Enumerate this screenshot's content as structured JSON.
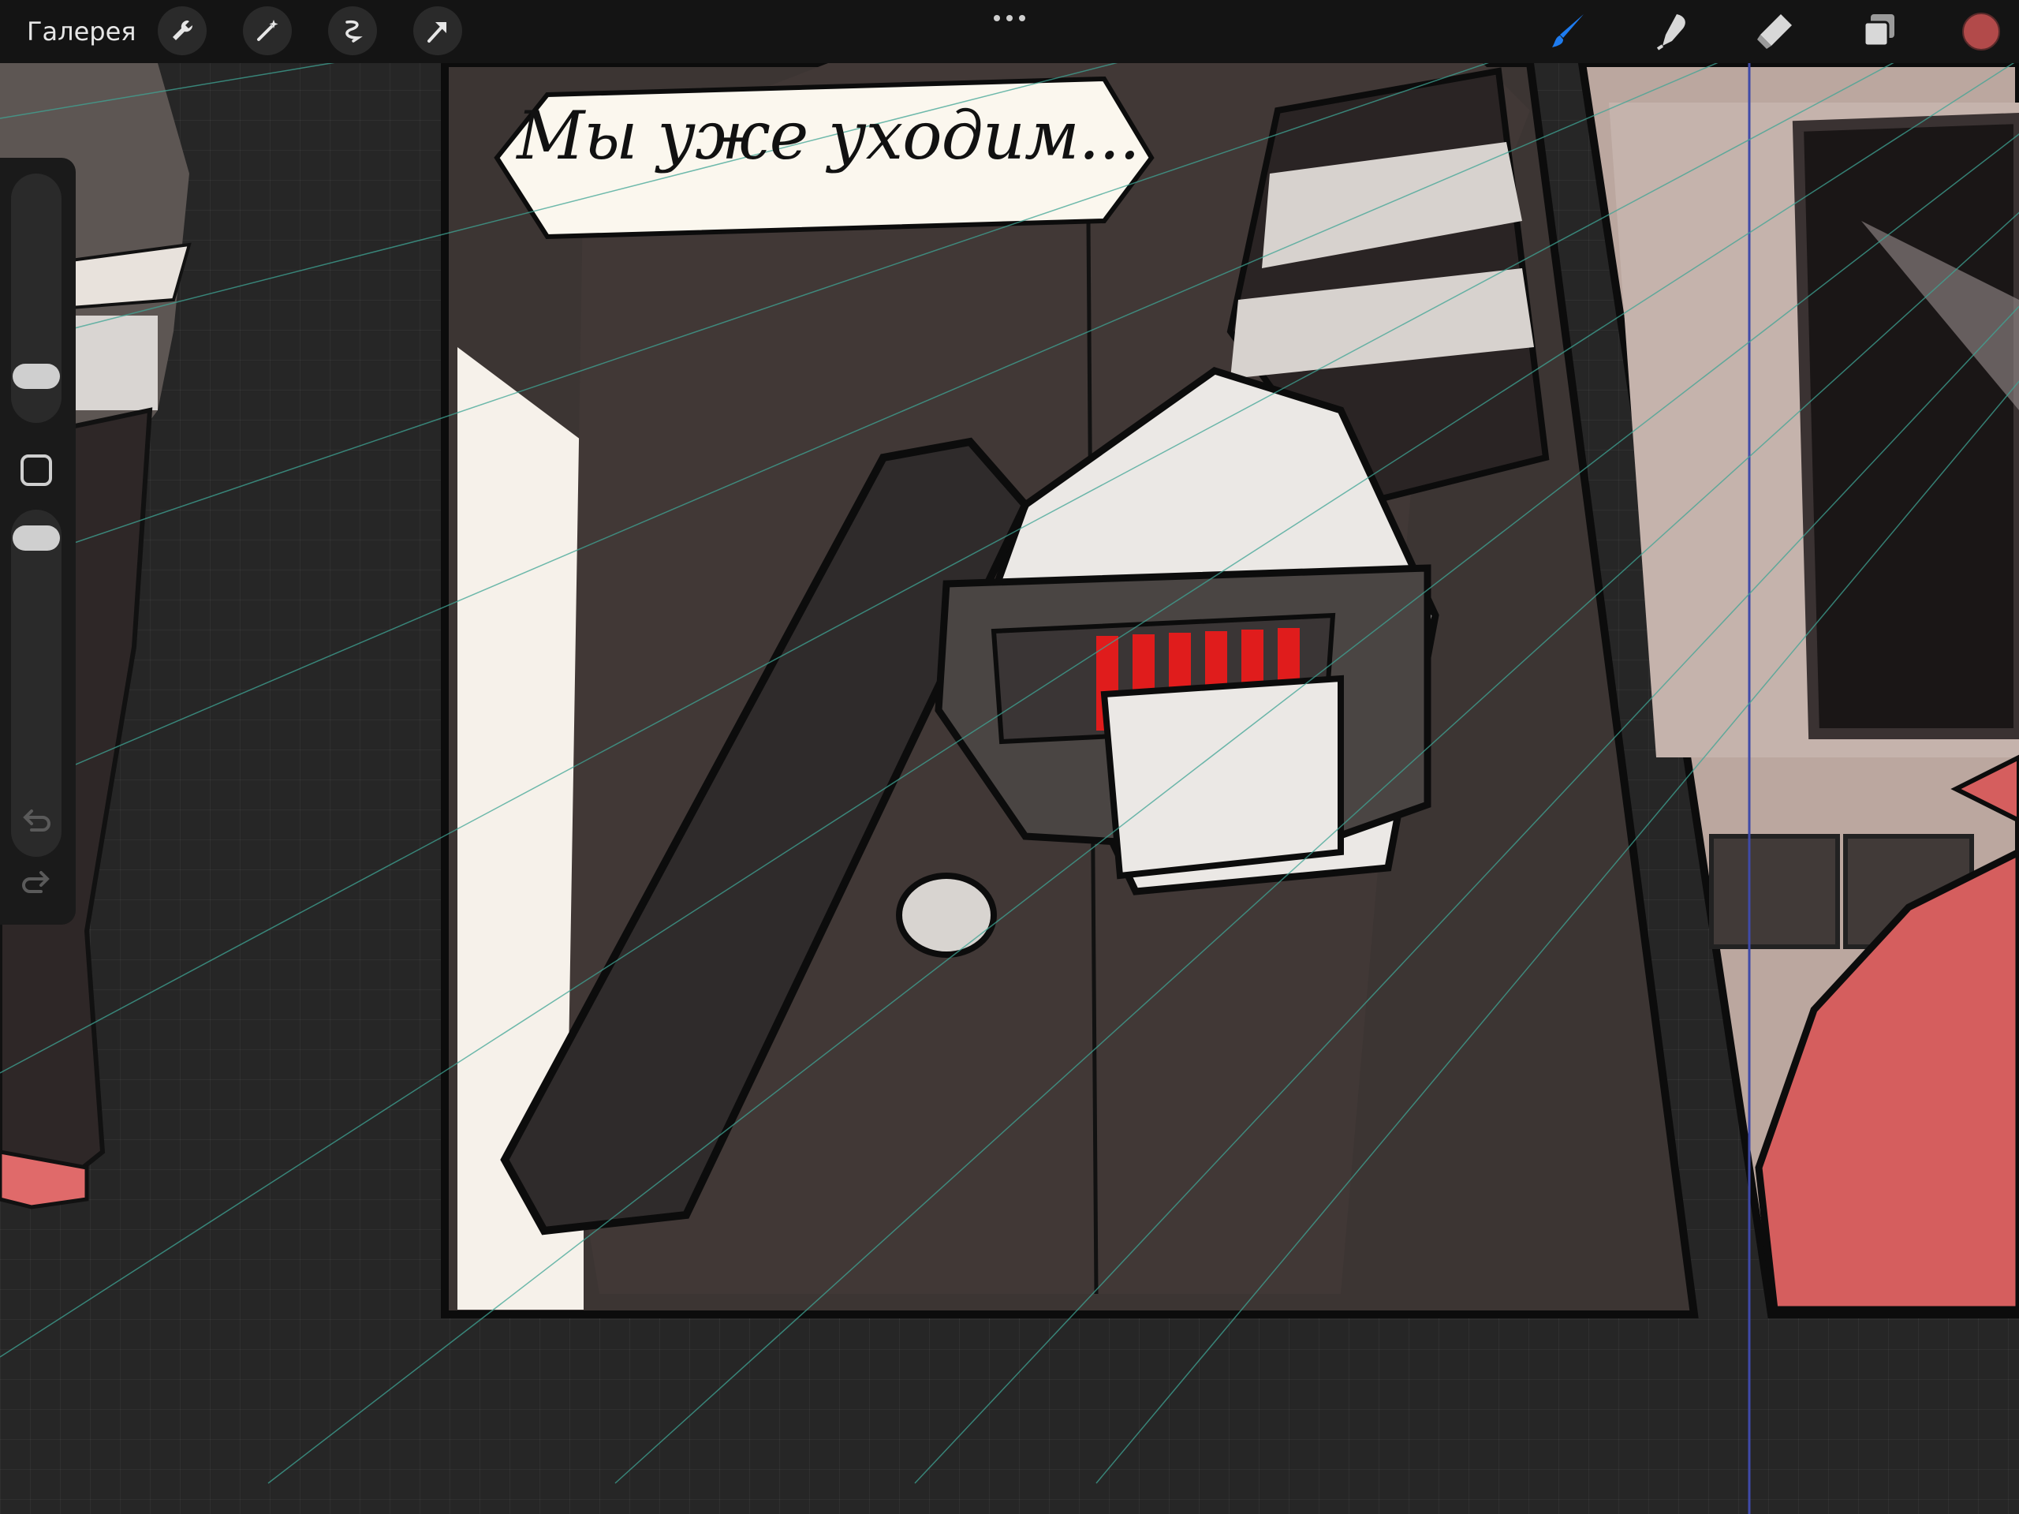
{
  "toolbar": {
    "gallery_label": "Галерея",
    "left_tools": [
      {
        "icon": "wrench-icon"
      },
      {
        "icon": "magic-wand-icon"
      },
      {
        "icon": "selection-icon"
      },
      {
        "icon": "transform-arrow-icon"
      }
    ],
    "right_tools": [
      {
        "icon": "brush-icon",
        "active": true
      },
      {
        "icon": "smudge-icon"
      },
      {
        "icon": "eraser-icon"
      },
      {
        "icon": "layers-icon"
      }
    ],
    "current_color": "#b24a4a",
    "accent_color": "#1e7cf0"
  },
  "sidebar": {
    "brush_size_level": 0.15,
    "opacity_level": 0.95
  },
  "canvas": {
    "speech_bubble_text": "Мы уже уходим..."
  }
}
